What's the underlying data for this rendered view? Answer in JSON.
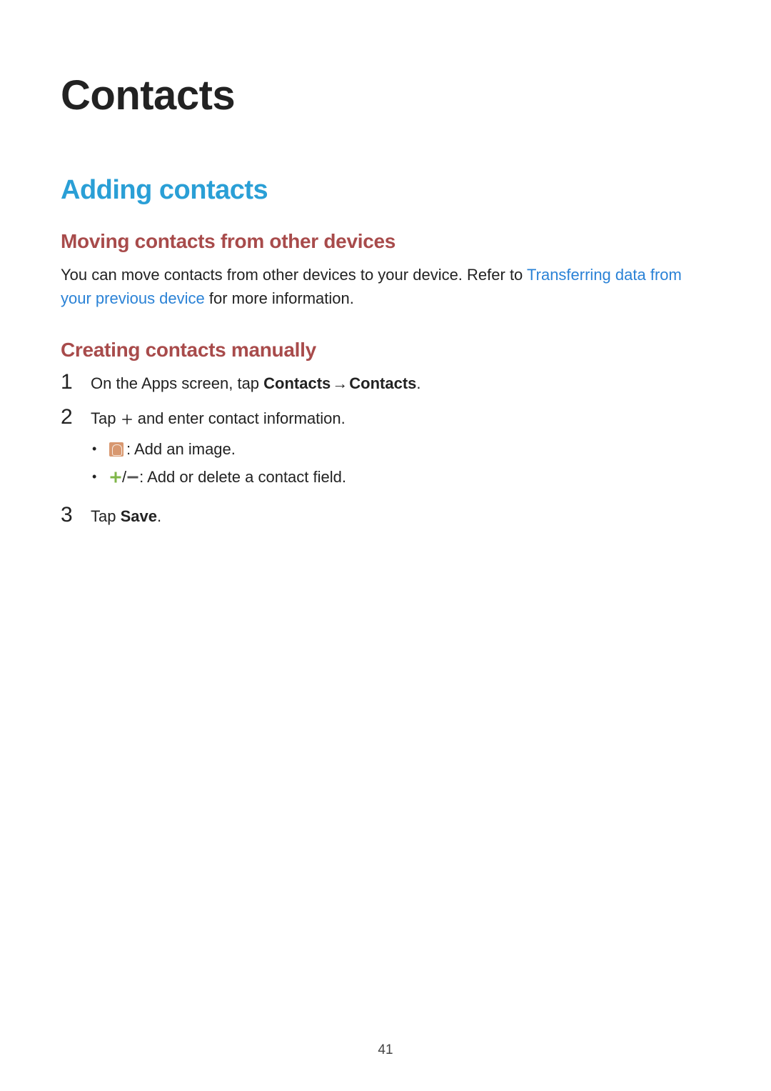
{
  "page": {
    "title": "Contacts",
    "number": "41"
  },
  "section": {
    "title": "Adding contacts"
  },
  "moving": {
    "title": "Moving contacts from other devices",
    "text_pre": "You can move contacts from other devices to your device. Refer to ",
    "link": "Transferring data from your previous device",
    "text_post": " for more information."
  },
  "creating": {
    "title": "Creating contacts manually",
    "steps": {
      "s1": {
        "num": "1",
        "pre": "On the Apps screen, tap ",
        "b1": "Contacts",
        "arrow": " → ",
        "b2": "Contacts",
        "post": "."
      },
      "s2": {
        "num": "2",
        "pre": "Tap ",
        "post": " and enter contact information.",
        "sub1": " : Add an image.",
        "sub2_sep": " / ",
        "sub2_post": " : Add or delete a contact field."
      },
      "s3": {
        "num": "3",
        "pre": "Tap ",
        "b1": "Save",
        "post": "."
      }
    }
  }
}
